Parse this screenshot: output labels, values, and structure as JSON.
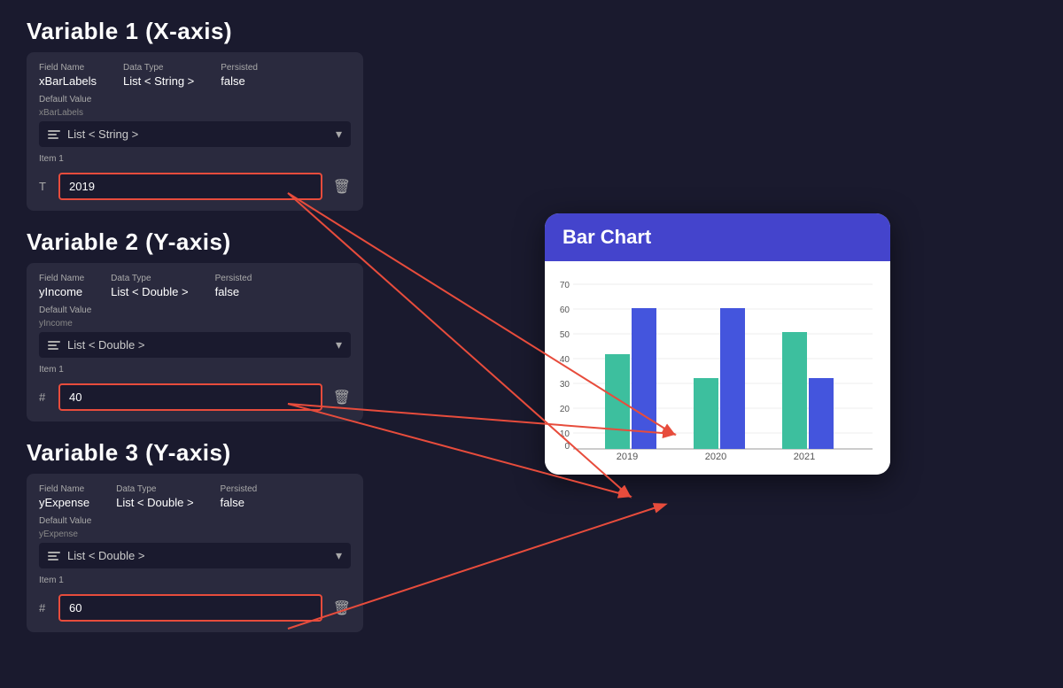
{
  "variables": [
    {
      "title": "Variable 1 (X-axis)",
      "fieldName": {
        "label": "Field Name",
        "value": "xBarLabels"
      },
      "dataType": {
        "label": "Data Type",
        "value": "List < String >"
      },
      "persisted": {
        "label": "Persisted",
        "value": "false"
      },
      "defaultValue": {
        "label": "Default Value",
        "sublabel": "xBarLabels",
        "dropdownText": "List < String >"
      },
      "item": {
        "label": "Item 1",
        "prefix": "T",
        "value": "2019",
        "type": "text"
      }
    },
    {
      "title": "Variable 2 (Y-axis)",
      "fieldName": {
        "label": "Field Name",
        "value": "yIncome"
      },
      "dataType": {
        "label": "Data Type",
        "value": "List < Double >"
      },
      "persisted": {
        "label": "Persisted",
        "value": "false"
      },
      "defaultValue": {
        "label": "Default Value",
        "sublabel": "yIncome",
        "dropdownText": "List < Double >"
      },
      "item": {
        "label": "Item 1",
        "prefix": "#",
        "value": "40",
        "type": "number"
      }
    },
    {
      "title": "Variable 3 (Y-axis)",
      "fieldName": {
        "label": "Field Name",
        "value": "yExpense"
      },
      "dataType": {
        "label": "Data Type",
        "value": "List < Double >"
      },
      "persisted": {
        "label": "Persisted",
        "value": "false"
      },
      "defaultValue": {
        "label": "Default Value",
        "sublabel": "yExpense",
        "dropdownText": "List < Double >"
      },
      "item": {
        "label": "Item 1",
        "prefix": "#",
        "value": "60",
        "type": "number"
      }
    }
  ],
  "chart": {
    "title": "Bar Chart",
    "headerColor": "#4444cc",
    "yAxisLabels": [
      "0",
      "10",
      "20",
      "30",
      "40",
      "50",
      "60",
      "70"
    ],
    "xAxisLabels": [
      "2019",
      "2020",
      "2021"
    ],
    "bars": [
      {
        "group": "2019",
        "income": 40,
        "expense": 60
      },
      {
        "group": "2020",
        "income": 30,
        "expense": 60
      },
      {
        "group": "2021",
        "income": 50,
        "expense": 30
      }
    ],
    "colors": {
      "income": "#3dbf9e",
      "expense": "#4455dd"
    },
    "maxValue": 70
  }
}
